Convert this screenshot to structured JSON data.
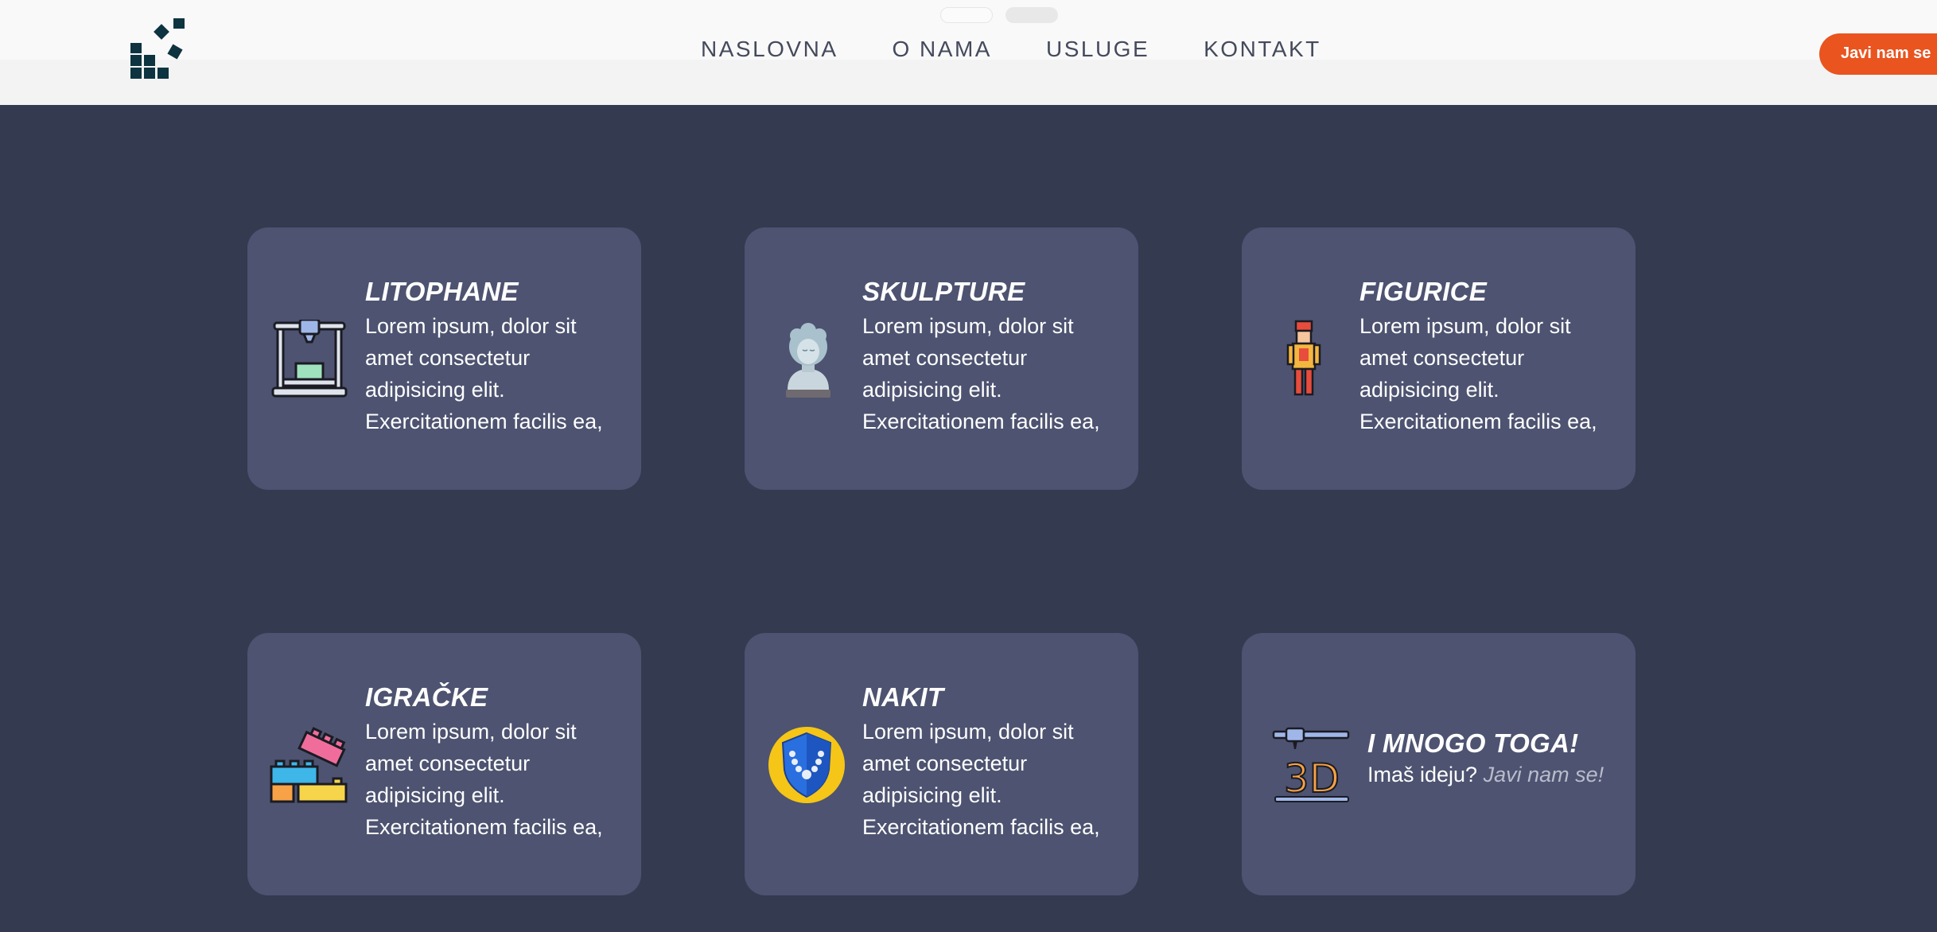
{
  "header": {
    "nav": [
      "NASLOVNA",
      "O NAMA",
      "USLUGE",
      "KONTAKT"
    ],
    "cta_label": "Javi nam se"
  },
  "cards": [
    {
      "title": "LITOPHANE",
      "lines": [
        "Lorem ipsum, dolor sit",
        "amet consectetur",
        "adipisicing elit.",
        "Exercitationem facilis ea,"
      ],
      "icon": "3d-printer-icon"
    },
    {
      "title": "SKULPTURE",
      "lines": [
        "Lorem ipsum, dolor sit",
        "amet consectetur",
        "adipisicing elit.",
        "Exercitationem facilis ea,"
      ],
      "icon": "bust-sculpture-icon"
    },
    {
      "title": "FIGURICE",
      "lines": [
        "Lorem ipsum, dolor sit",
        "amet consectetur",
        "adipisicing elit.",
        "Exercitationem facilis ea,"
      ],
      "icon": "toy-soldier-icon"
    },
    {
      "title": "IGRAČKE",
      "lines": [
        "Lorem ipsum, dolor sit",
        "amet consectetur",
        "adipisicing elit.",
        "Exercitationem facilis ea,"
      ],
      "icon": "lego-bricks-icon"
    },
    {
      "title": "NAKIT",
      "lines": [
        "Lorem ipsum, dolor sit",
        "amet consectetur",
        "adipisicing elit.",
        "Exercitationem facilis ea,"
      ],
      "icon": "necklace-shield-icon"
    },
    {
      "title": "I MNOGO TOGA!",
      "text": "Imaš ideju?",
      "link": "Javi nam se!",
      "icon": "3d-pen-icon"
    }
  ],
  "colors": {
    "background": "#343a4f",
    "card": "#4d5370",
    "accent": "#e9541f",
    "logo": "#0d3440"
  }
}
